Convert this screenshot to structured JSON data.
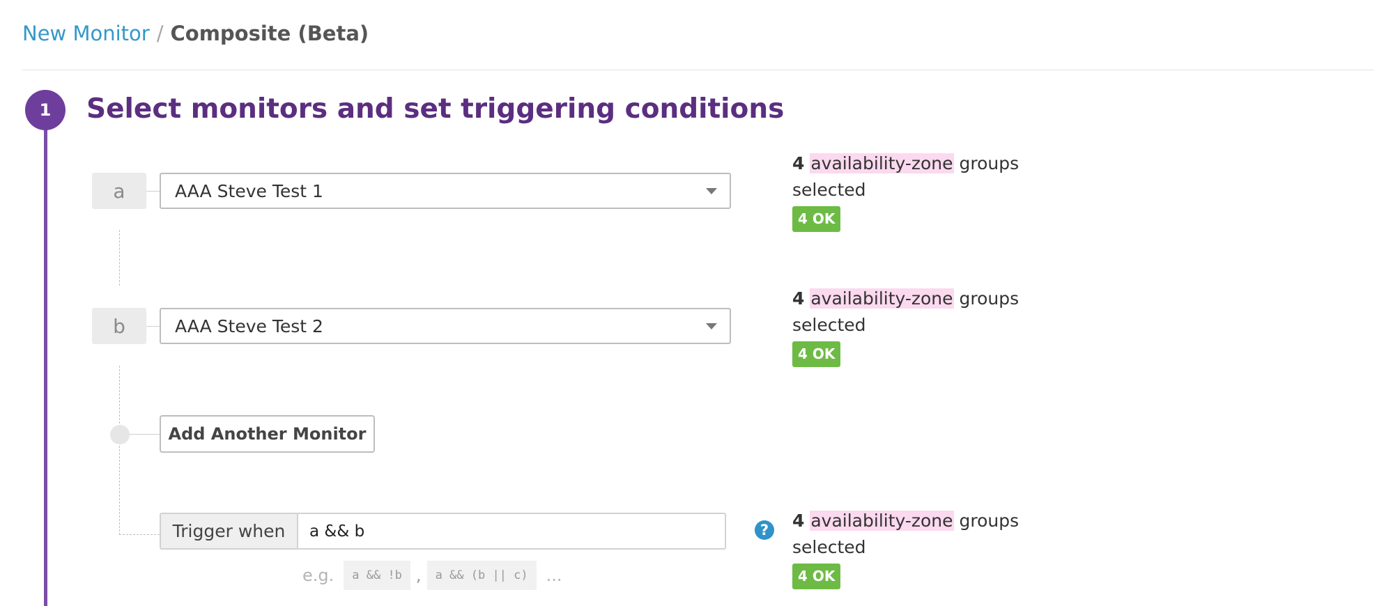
{
  "breadcrumb": {
    "parent": "New Monitor",
    "separator": "/",
    "current": "Composite (Beta)"
  },
  "step": {
    "number": "1",
    "title": "Select monitors and set triggering conditions"
  },
  "monitors": [
    {
      "letter": "a",
      "selected": "AAA Steve Test 1",
      "info": {
        "count": "4",
        "tag": "availability-zone",
        "rest": "groups",
        "line2": "selected",
        "status": "4 OK"
      }
    },
    {
      "letter": "b",
      "selected": "AAA Steve Test 2",
      "info": {
        "count": "4",
        "tag": "availability-zone",
        "rest": "groups",
        "line2": "selected",
        "status": "4 OK"
      }
    }
  ],
  "add_button": "Add Another Monitor",
  "trigger": {
    "label": "Trigger when",
    "value": "a && b",
    "help": "?",
    "examples_prefix": "e.g.",
    "examples": [
      "a && !b",
      "a && (b || c)"
    ],
    "examples_sep": ",",
    "ellipsis": "...",
    "info": {
      "count": "4",
      "tag": "availability-zone",
      "rest": "groups",
      "line2": "selected",
      "status": "4 OK"
    }
  },
  "colors": {
    "accent": "#6e3e9c",
    "link": "#3498c9",
    "ok": "#6dbb45",
    "tag_bg": "#fbd9ef",
    "help": "#2f93c9"
  },
  "icons": {
    "dropdown": "caret-down-icon",
    "help": "question-circle-icon"
  }
}
